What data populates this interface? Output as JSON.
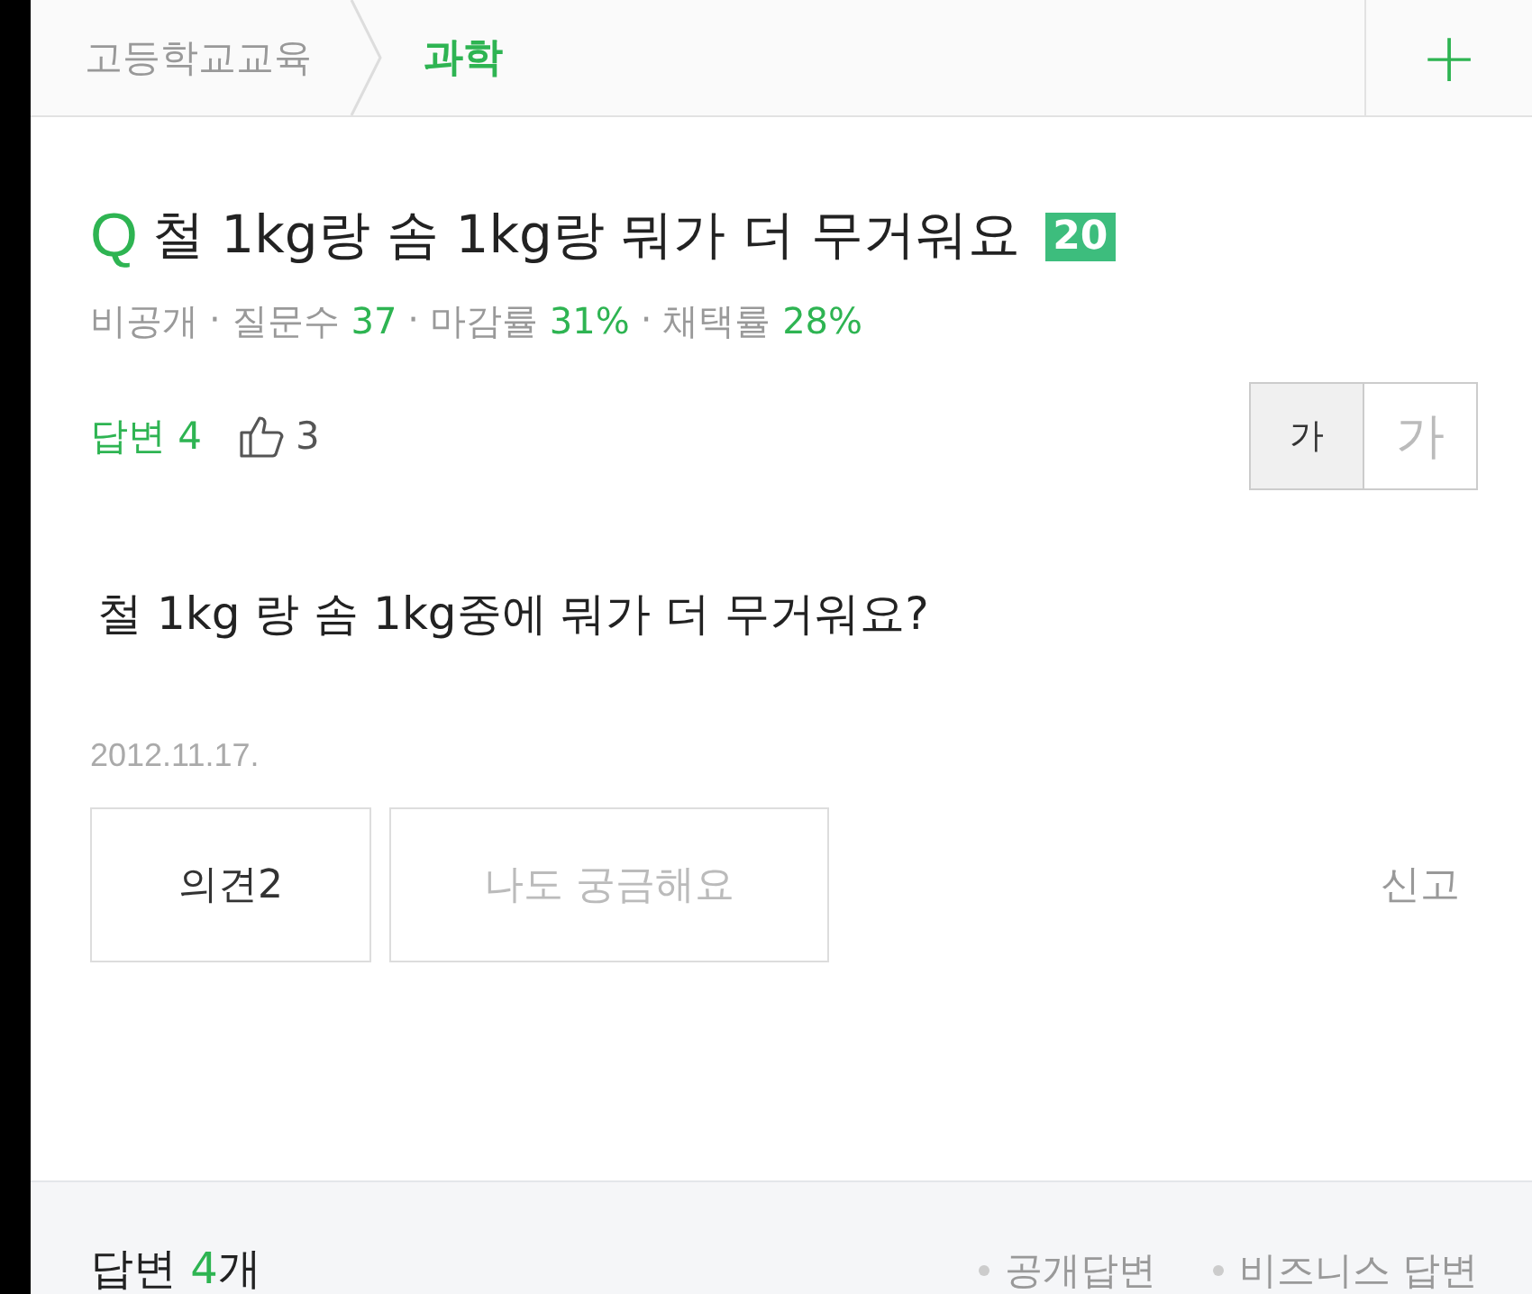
{
  "breadcrumb": {
    "parent": "고등학교교육",
    "current": "과학",
    "add": "+"
  },
  "question": {
    "marker": "Q",
    "title": "철 1kg랑 솜 1kg랑 뭐가 더 무거워요",
    "points": "20",
    "separator": "·",
    "meta": [
      {
        "label": "비공개"
      },
      {
        "label": "질문수",
        "value": "37"
      },
      {
        "label": "마감률",
        "value": "31%"
      },
      {
        "label": "채택률",
        "value": "28%"
      }
    ],
    "answers_label": "답변 4",
    "likes": "3",
    "font_sizes": [
      {
        "label": "가",
        "kind": "small",
        "selected": true
      },
      {
        "label": "가",
        "kind": "large",
        "selected": false
      }
    ],
    "body": "철 1kg 랑 솜 1kg중에 뭐가 더 무거워요?",
    "date": "2012.11.17.",
    "buttons": [
      {
        "label": "의견2",
        "kind": "active"
      },
      {
        "label": "나도 궁금해요",
        "kind": "muted"
      }
    ],
    "report": "신고"
  },
  "answers": {
    "label": "답변 ",
    "count": "4",
    "unit": "개",
    "filters": [
      "공개답변",
      "비즈니스 답변"
    ]
  }
}
